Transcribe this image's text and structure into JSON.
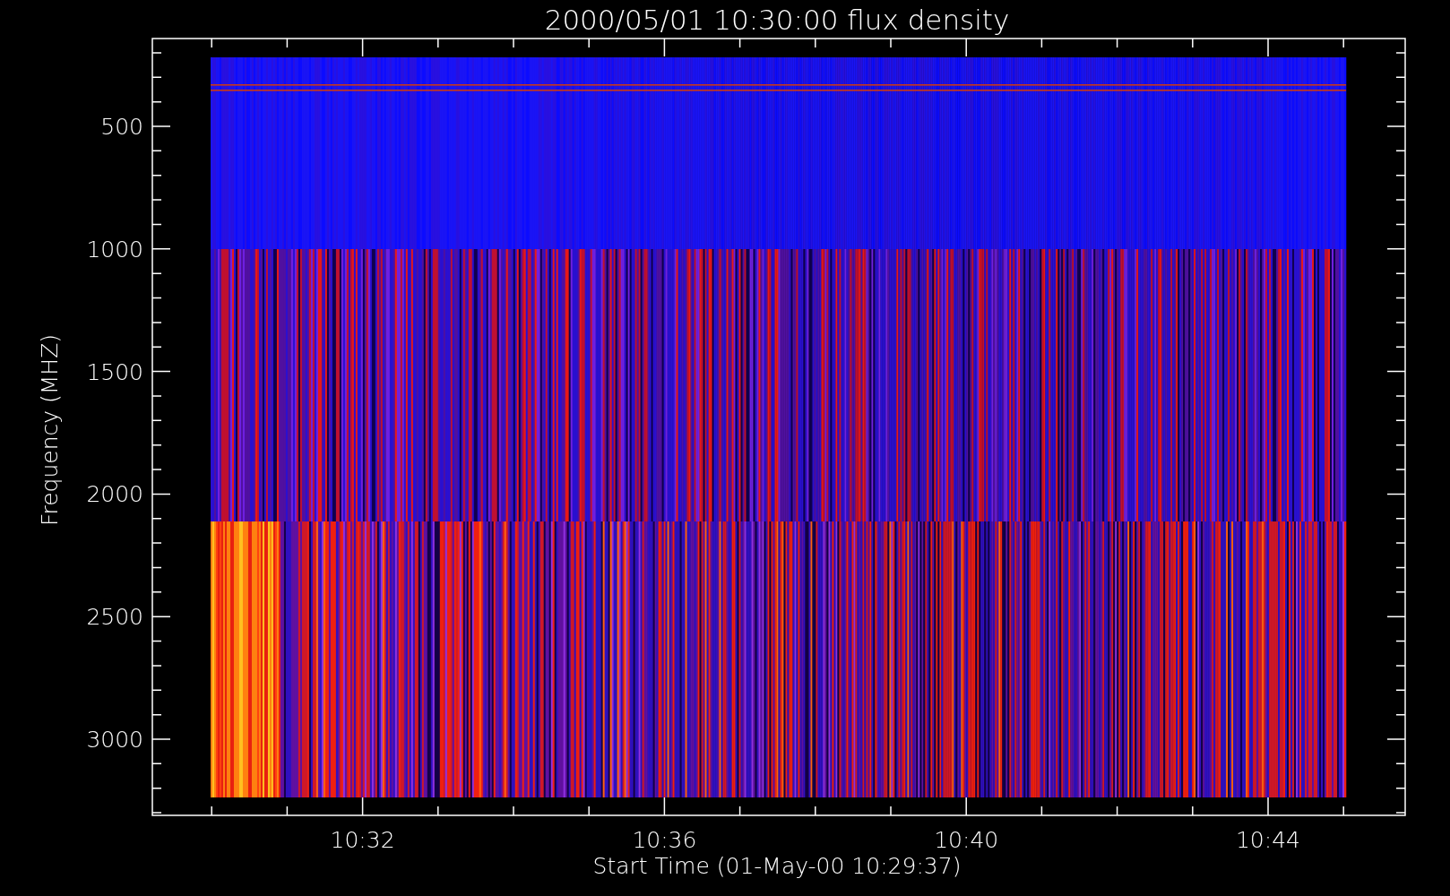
{
  "plot": {
    "title": "2000/05/01 10:30:00 flux density",
    "ylabel": "Frequency (MHZ)",
    "xlabel": "Start Time (01-May-00 10:29:37)",
    "yticks": [
      "500",
      "1000",
      "1500",
      "2000",
      "2500",
      "3000"
    ],
    "xticks": [
      "10:32",
      "10:36",
      "10:40",
      "10:44"
    ]
  }
}
